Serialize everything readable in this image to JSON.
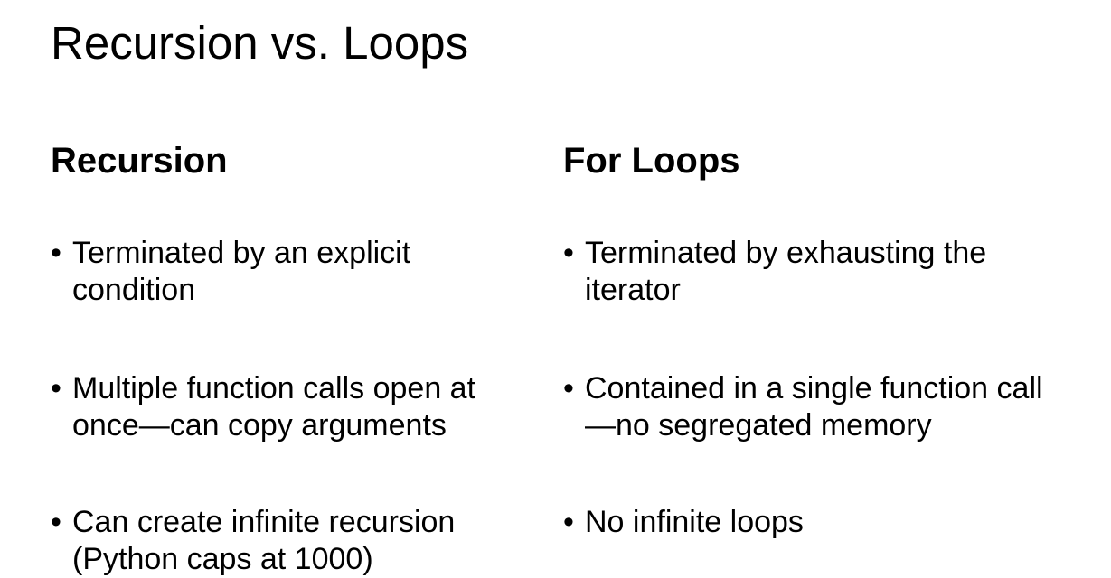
{
  "slide": {
    "title": "Recursion vs. Loops",
    "bullet_glyph": "•",
    "columns": [
      {
        "heading": "Recursion",
        "bullets": [
          "Terminated by an explicit condition",
          "Multiple function calls open at once—can copy arguments",
          "Can create infinite recursion (Python caps at 1000)"
        ]
      },
      {
        "heading": "For Loops",
        "bullets": [
          "Terminated by exhausting the iterator",
          "Contained in a single function call—no segregated memory",
          "No infinite loops"
        ]
      }
    ]
  }
}
